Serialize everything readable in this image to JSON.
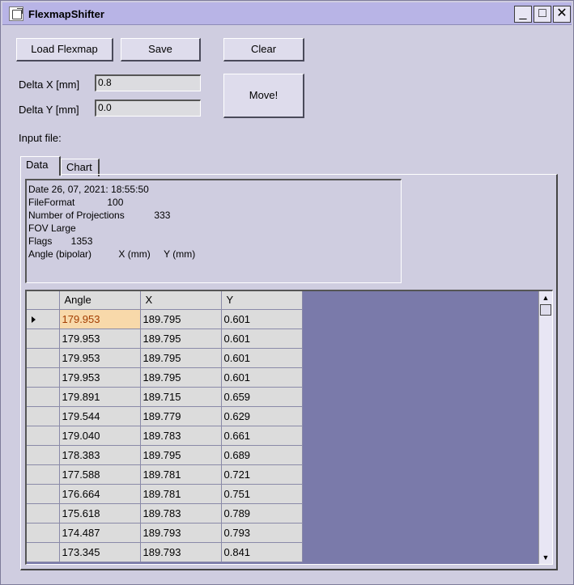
{
  "window": {
    "title": "FlexmapShifter",
    "minimize_glyph": "_",
    "maximize_glyph": "□",
    "close_glyph": "✕"
  },
  "toolbar": {
    "load_label": "Load Flexmap",
    "save_label": "Save",
    "clear_label": "Clear",
    "move_label": "Move!"
  },
  "delta": {
    "x_label": "Delta X [mm]",
    "x_value": "0.8",
    "y_label": "Delta Y [mm]",
    "y_value": "0.0"
  },
  "input_file_label": "Input file:",
  "tabs": [
    {
      "label": "Data",
      "active": true
    },
    {
      "label": "Chart",
      "active": false
    }
  ],
  "header_info": [
    "Date 26, 07, 2021: 18:55:50",
    "FileFormat            100",
    "Number of Projections           333",
    "FOV Large",
    "Flags       1353",
    "Angle (bipolar)          X (mm)     Y (mm)"
  ],
  "grid": {
    "columns": [
      "Angle",
      "X",
      "Y"
    ],
    "rows": [
      [
        "179.953",
        "189.795",
        "0.601"
      ],
      [
        "179.953",
        "189.795",
        "0.601"
      ],
      [
        "179.953",
        "189.795",
        "0.601"
      ],
      [
        "179.953",
        "189.795",
        "0.601"
      ],
      [
        "179.891",
        "189.715",
        "0.659"
      ],
      [
        "179.544",
        "189.779",
        "0.629"
      ],
      [
        "179.040",
        "189.783",
        "0.661"
      ],
      [
        "178.383",
        "189.795",
        "0.689"
      ],
      [
        "177.588",
        "189.781",
        "0.721"
      ],
      [
        "176.664",
        "189.781",
        "0.751"
      ],
      [
        "175.618",
        "189.783",
        "0.789"
      ],
      [
        "174.487",
        "189.793",
        "0.793"
      ],
      [
        "173.345",
        "189.793",
        "0.841"
      ]
    ]
  },
  "scrollbar": {
    "up_glyph": "▲",
    "down_glyph": "▼"
  }
}
